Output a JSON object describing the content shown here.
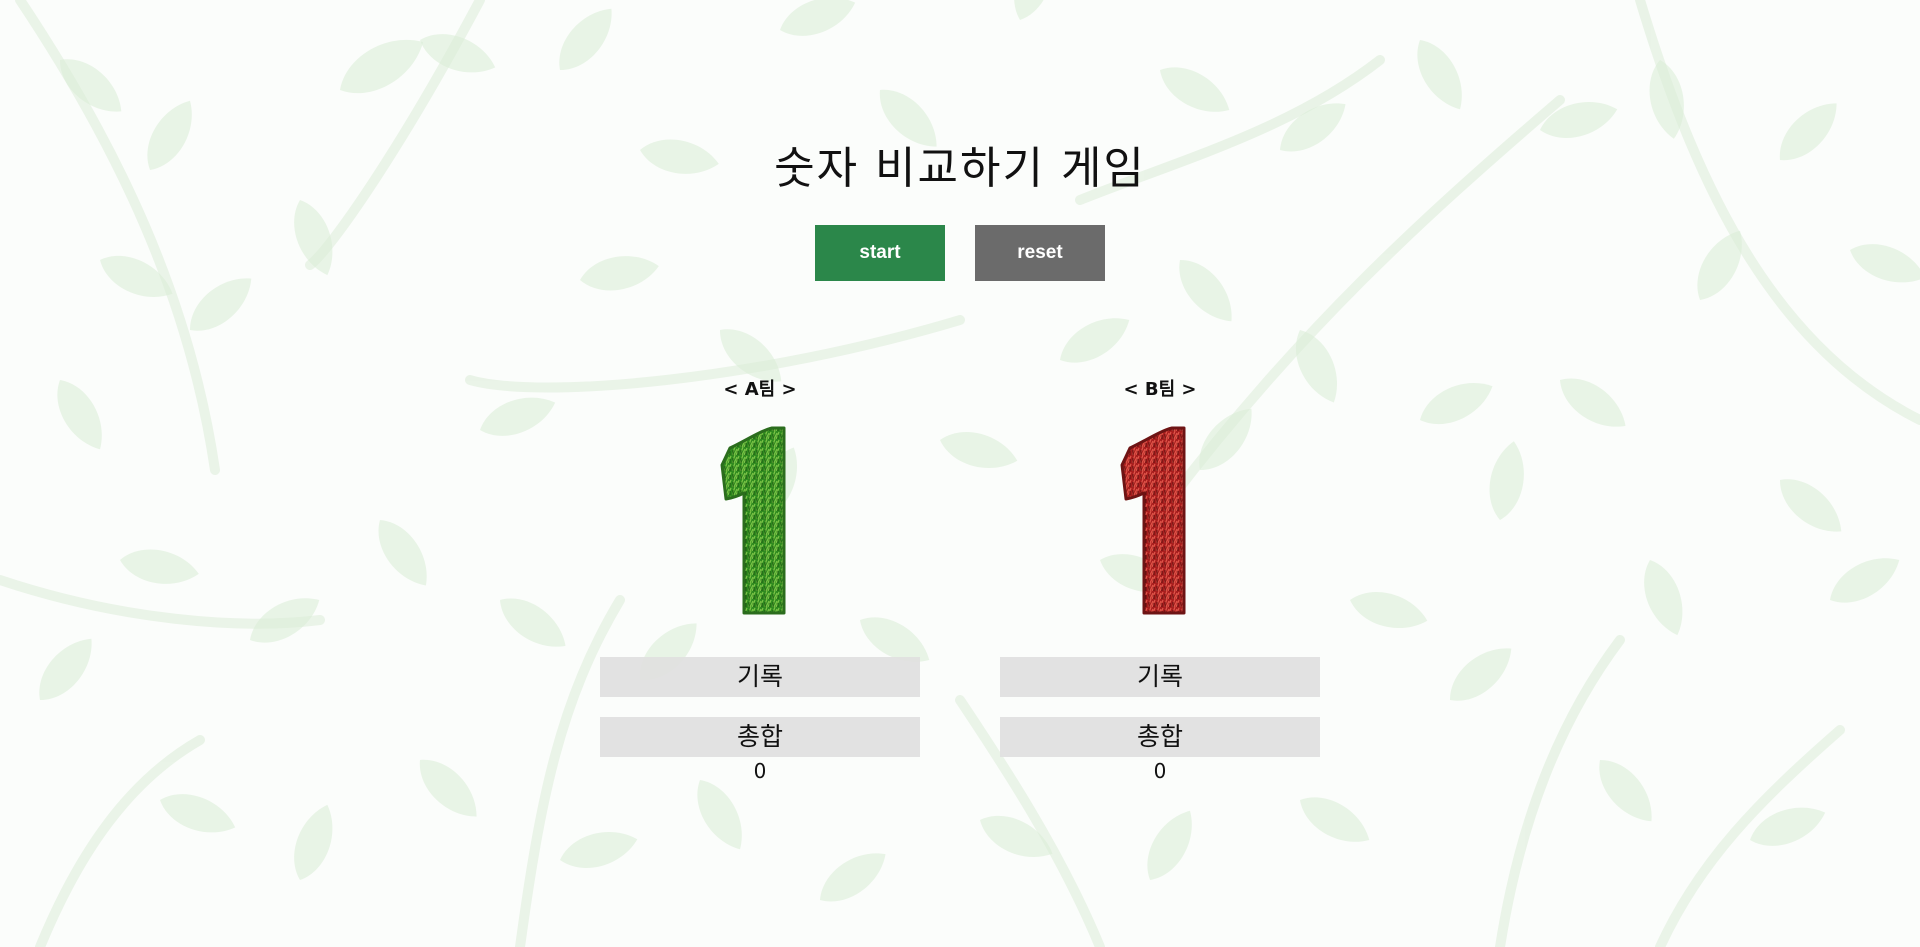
{
  "title": "숫자 비교하기 게임",
  "buttons": {
    "start_label": "start",
    "reset_label": "reset"
  },
  "teams": [
    {
      "label": "< A팀 >",
      "digit": "1",
      "record_label": "기록",
      "total_label": "총합",
      "total_value": "0",
      "color": "#2f8a1f"
    },
    {
      "label": "< B팀 >",
      "digit": "1",
      "record_label": "기록",
      "total_label": "총합",
      "total_value": "0",
      "color": "#a81e1e"
    }
  ],
  "colors": {
    "start_button": "#2b874a",
    "reset_button": "#6b6b6b",
    "info_box": "#e0e0e0"
  }
}
